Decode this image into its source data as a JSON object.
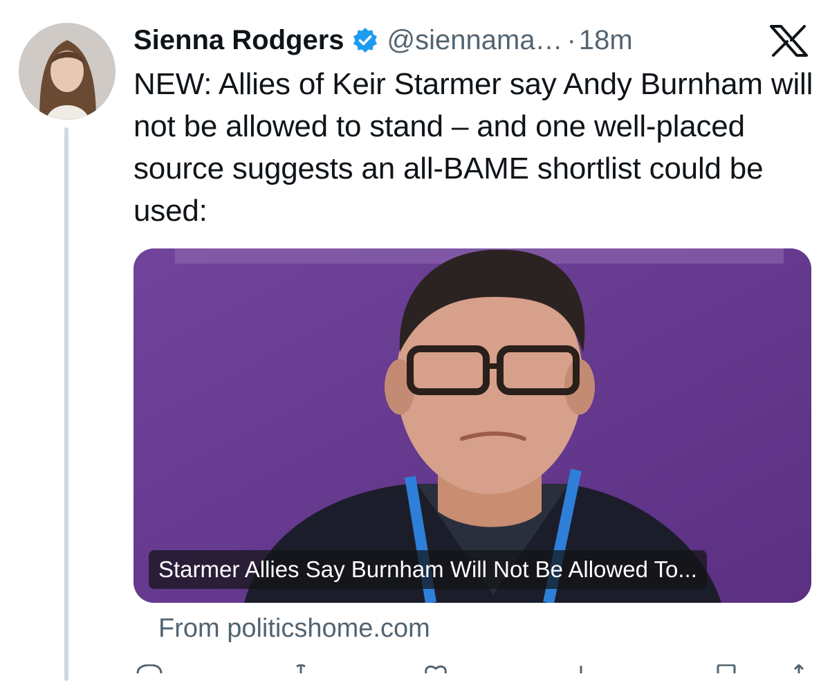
{
  "author": {
    "name": "Sienna Rodgers",
    "handle": "@siennama…",
    "separator": "·",
    "time": "18m",
    "verified": true
  },
  "tweet": {
    "text": "NEW: Allies of Keir Starmer say Andy Burnham will not be allowed to stand – and one well-placed source suggests an all-BAME shortlist could be used:"
  },
  "card": {
    "caption": "Starmer Allies Say Burnham Will Not Be Allowed To...",
    "source": "From politicshome.com"
  },
  "colors": {
    "verified_badge": "#1d9bf0",
    "card_background": "#6a3d8e",
    "secondary_text": "#536471"
  },
  "icons": [
    "x-logo-icon",
    "verified-badge-icon",
    "reply-icon",
    "retweet-icon",
    "like-icon",
    "views-icon",
    "bookmark-icon",
    "share-icon"
  ]
}
